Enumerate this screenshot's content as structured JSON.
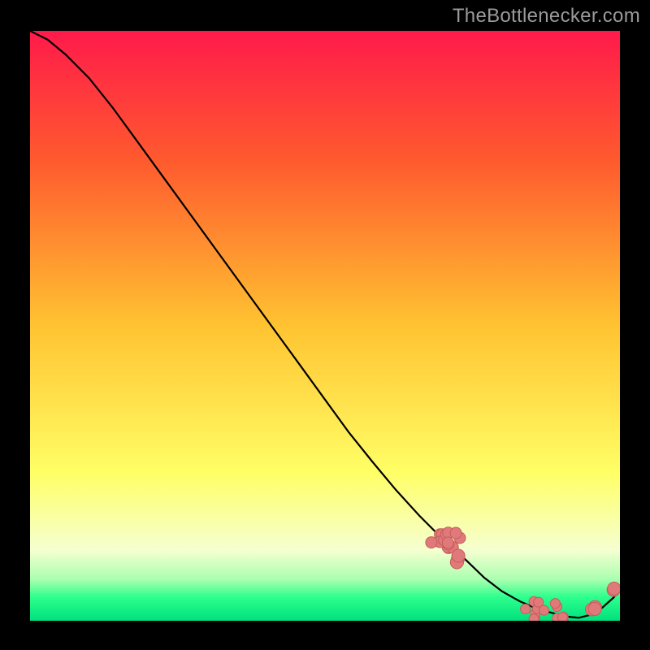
{
  "watermark": "TheBottlenecker.com",
  "colors": {
    "frame": "#000000",
    "watermark_text": "#9a9a9a",
    "curve": "#000000",
    "dot_fill": "#e07a7a",
    "dot_stroke": "#c75c5c",
    "gradient_top": "#ff1a4b",
    "gradient_upper": "#ff5a2e",
    "gradient_mid": "#ffc331",
    "gradient_low": "#ffff66",
    "gradient_pale": "#f5ffd0",
    "gradient_green_light": "#aaffb0",
    "gradient_green": "#2dff8c",
    "gradient_green_dark": "#00e07e"
  },
  "chart_data": {
    "type": "line",
    "x": [
      0.0,
      0.03,
      0.06,
      0.1,
      0.14,
      0.18,
      0.22,
      0.26,
      0.3,
      0.34,
      0.38,
      0.42,
      0.46,
      0.5,
      0.54,
      0.58,
      0.62,
      0.66,
      0.7,
      0.74,
      0.77,
      0.8,
      0.83,
      0.86,
      0.89,
      0.91,
      0.93,
      0.95,
      0.97,
      0.99,
      1.0
    ],
    "y": [
      1.0,
      0.985,
      0.96,
      0.92,
      0.87,
      0.815,
      0.76,
      0.705,
      0.65,
      0.595,
      0.54,
      0.485,
      0.43,
      0.375,
      0.32,
      0.27,
      0.222,
      0.178,
      0.138,
      0.102,
      0.073,
      0.05,
      0.033,
      0.02,
      0.012,
      0.007,
      0.005,
      0.01,
      0.022,
      0.04,
      0.058
    ],
    "title": "",
    "xlabel": "",
    "ylabel": "",
    "xlim": [
      0,
      1
    ],
    "ylim": [
      0,
      1
    ],
    "dot_clusters": [
      {
        "cx": 0.705,
        "cy": 0.135,
        "n": 14,
        "spread": 0.025,
        "r": 7
      },
      {
        "cx": 0.73,
        "cy": 0.104,
        "n": 4,
        "spread": 0.012,
        "r": 8
      },
      {
        "cx": 0.87,
        "cy": 0.01,
        "n": 18,
        "spread": 0.04,
        "r": 6
      },
      {
        "cx": 0.956,
        "cy": 0.024,
        "n": 3,
        "spread": 0.01,
        "r": 8
      },
      {
        "cx": 0.992,
        "cy": 0.052,
        "n": 2,
        "spread": 0.006,
        "r": 8
      }
    ]
  }
}
